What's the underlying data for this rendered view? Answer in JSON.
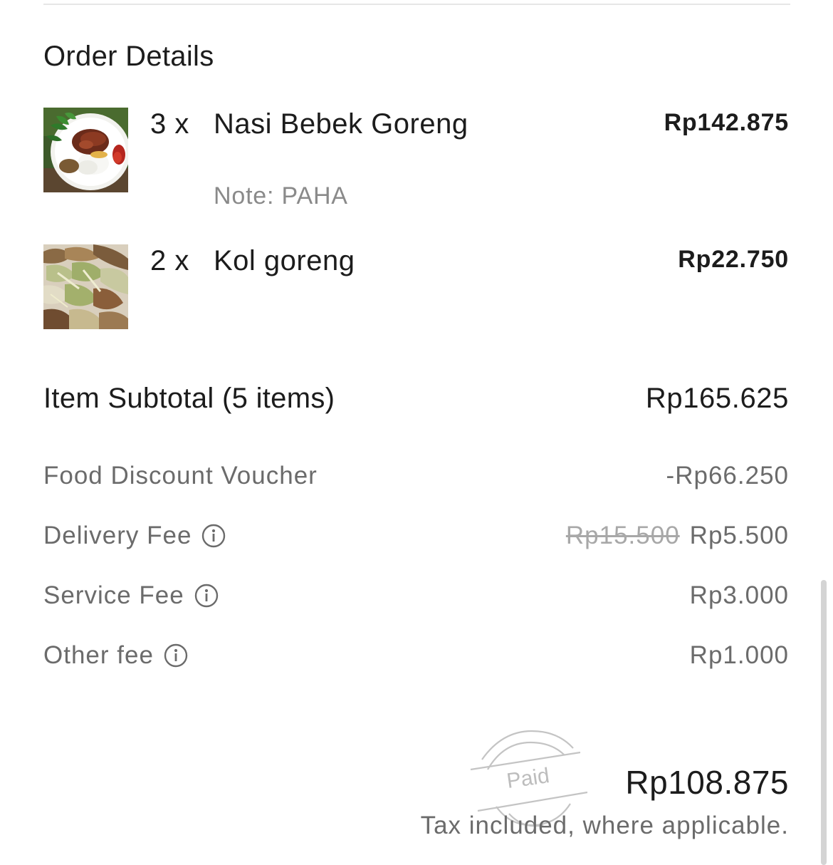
{
  "section_title": "Order Details",
  "items": [
    {
      "image_icon": "nasi-bebek-goreng-photo",
      "quantity": "3 x",
      "name": "Nasi Bebek Goreng",
      "price": "Rp142.875",
      "note": "Note: PAHA"
    },
    {
      "image_icon": "kol-goreng-photo",
      "quantity": "2 x",
      "name": "Kol goreng",
      "price": "Rp22.750"
    }
  ],
  "subtotal": {
    "label": "Item Subtotal (5 items)",
    "value": "Rp165.625"
  },
  "fees": [
    {
      "label": "Food Discount Voucher",
      "value": "-Rp66.250"
    },
    {
      "label": "Delivery Fee",
      "original_value": "Rp15.500",
      "value": "Rp5.500",
      "icon": "info-icon"
    },
    {
      "label": "Service Fee",
      "value": "Rp3.000",
      "icon": "info-icon"
    },
    {
      "label": "Other fee",
      "value": "Rp1.000",
      "icon": "info-icon"
    }
  ],
  "total": {
    "value": "Rp108.875",
    "tax_note": "Tax included, where applicable."
  },
  "stamp": {
    "text": "Paid"
  },
  "colors": {
    "primary_text": "#1c1c1c",
    "secondary_text": "#6b6b6b",
    "strikethrough_text": "#a8a8a8",
    "stamp": "#b8b8b8"
  }
}
